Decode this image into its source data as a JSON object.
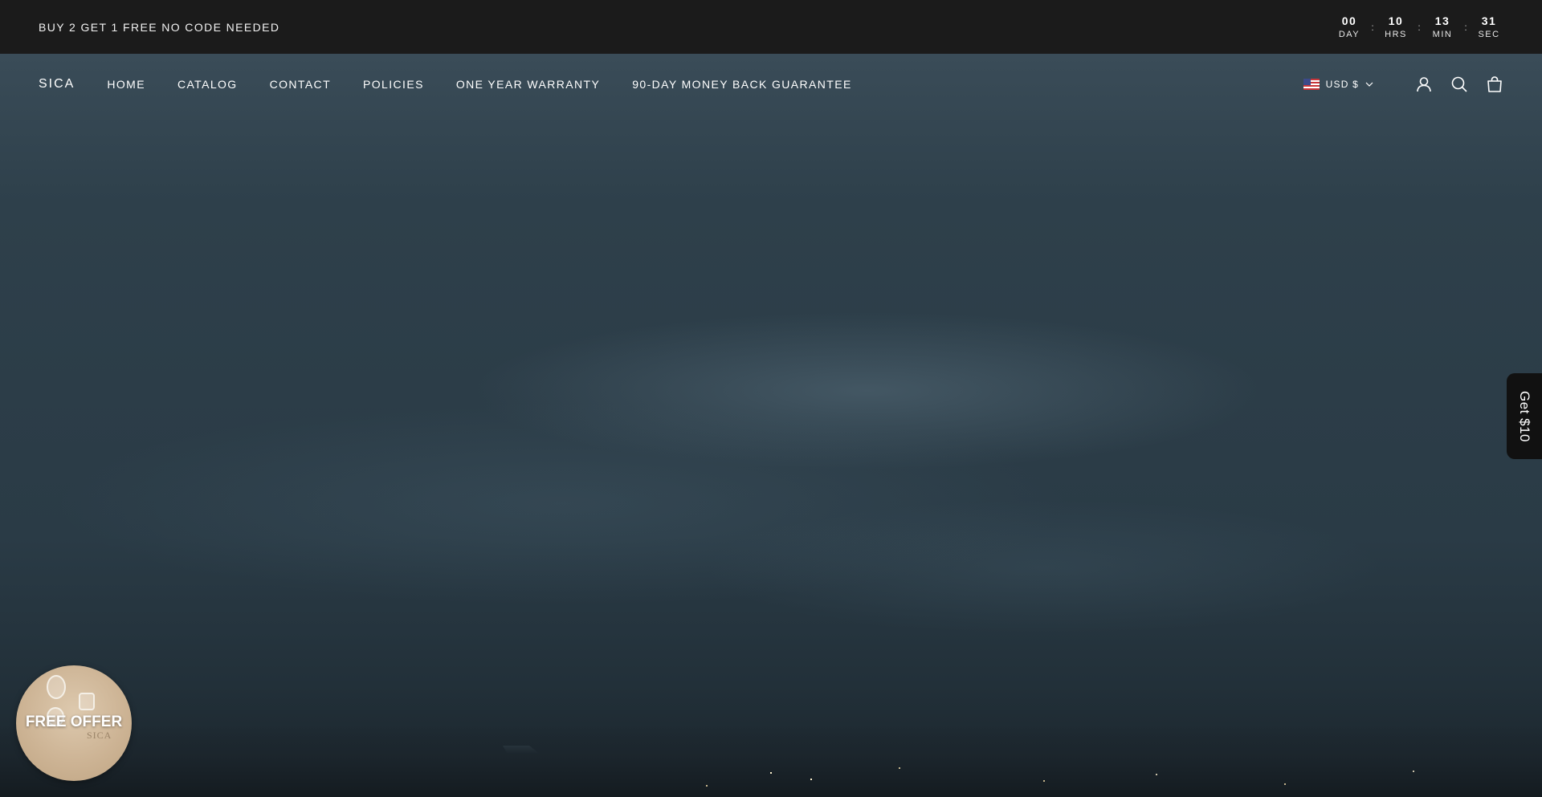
{
  "announcement": {
    "text": "BUY 2 GET 1 FREE NO CODE NEEDED",
    "countdown": [
      {
        "value": "00",
        "label": "DAY"
      },
      {
        "value": "10",
        "label": "HRS"
      },
      {
        "value": "13",
        "label": "MIN"
      },
      {
        "value": "31",
        "label": "SEC"
      }
    ],
    "separator": ":"
  },
  "header": {
    "logo": "SICA",
    "nav": [
      {
        "label": "HOME"
      },
      {
        "label": "CATALOG"
      },
      {
        "label": "CONTACT"
      },
      {
        "label": "POLICIES"
      },
      {
        "label": "ONE YEAR WARRANTY"
      },
      {
        "label": "90-DAY MONEY BACK GUARANTEE"
      }
    ],
    "currency": "USD $",
    "icons": [
      "account-icon",
      "search-icon",
      "cart-icon"
    ]
  },
  "side_tab": {
    "label": "Get $10"
  },
  "offer_bubble": {
    "label": "FREE OFFER",
    "brand": "SICA"
  },
  "colors": {
    "announcement_bg": "#1b1b1b",
    "hero_bg": "#2c3d48",
    "side_tab_bg": "#111111",
    "offer_bg": "#cdb495"
  }
}
